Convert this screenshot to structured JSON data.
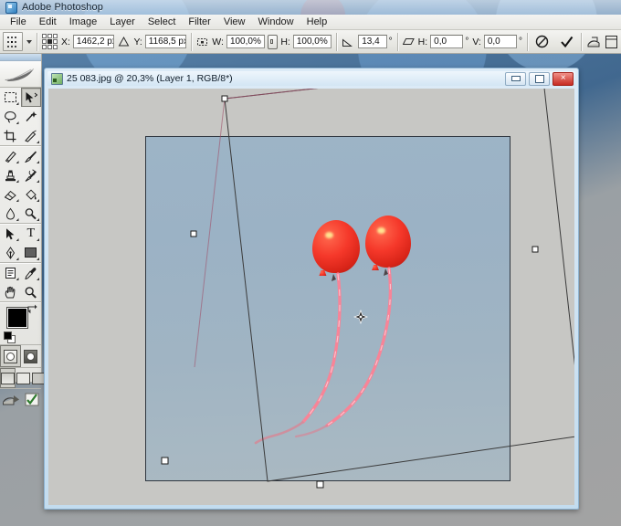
{
  "app": {
    "title": "Adobe Photoshop",
    "icon": "photoshop-icon"
  },
  "menubar": {
    "items": [
      {
        "label": "File"
      },
      {
        "label": "Edit"
      },
      {
        "label": "Image"
      },
      {
        "label": "Layer"
      },
      {
        "label": "Select"
      },
      {
        "label": "Filter"
      },
      {
        "label": "View"
      },
      {
        "label": "Window"
      },
      {
        "label": "Help"
      }
    ]
  },
  "options_bar": {
    "tool_preset_icon": "move-tool-preset-icon",
    "reference_point_label": "reference-point-grid",
    "reference_point_selected": "center",
    "x_label": "X:",
    "x_value": "1462,2 px",
    "delta_icon": "delta-triangle-icon",
    "y_label": "Y:",
    "y_value": "1168,5 px",
    "w_icon": "width-icon",
    "w_label": "W:",
    "w_value": "100,0%",
    "link_icon": "link-scale-icon",
    "h_label": "H:",
    "h_value": "100,0%",
    "angle_icon": "rotate-angle-icon",
    "angle_value": "13,4",
    "angle_unit": "°",
    "skew_icon": "skew-icon",
    "skew_h_label": "H:",
    "skew_h_value": "0,0",
    "skew_h_unit": "°",
    "skew_v_label": "V:",
    "skew_v_value": "0,0",
    "skew_v_unit": "°",
    "cancel_icon": "cancel-transform-icon",
    "commit_icon": "commit-transform-checkmark-icon",
    "warp_icon": "warp-mode-icon",
    "palette_icon": "palette-well-icon"
  },
  "toolbox": {
    "logo_icon": "photoshop-feather-logo",
    "tools": [
      {
        "name": "rectangular-marquee-tool",
        "icon": "marquee-icon",
        "selected": false,
        "has_flyout": true
      },
      {
        "name": "move-tool",
        "icon": "move-arrow-icon",
        "selected": true,
        "has_flyout": false
      },
      {
        "name": "lasso-tool",
        "icon": "lasso-icon",
        "selected": false,
        "has_flyout": true
      },
      {
        "name": "magic-wand-tool",
        "icon": "magic-wand-icon",
        "selected": false,
        "has_flyout": false
      },
      {
        "name": "crop-tool",
        "icon": "crop-icon",
        "selected": false,
        "has_flyout": false
      },
      {
        "name": "slice-tool",
        "icon": "slice-knife-icon",
        "selected": false,
        "has_flyout": true
      },
      {
        "name": "healing-brush-tool",
        "icon": "healing-brush-icon",
        "selected": false,
        "has_flyout": true
      },
      {
        "name": "brush-tool",
        "icon": "paintbrush-icon",
        "selected": false,
        "has_flyout": true
      },
      {
        "name": "clone-stamp-tool",
        "icon": "clone-stamp-icon",
        "selected": false,
        "has_flyout": true
      },
      {
        "name": "history-brush-tool",
        "icon": "history-brush-icon",
        "selected": false,
        "has_flyout": true
      },
      {
        "name": "eraser-tool",
        "icon": "eraser-icon",
        "selected": false,
        "has_flyout": true
      },
      {
        "name": "gradient-tool",
        "icon": "paint-bucket-icon",
        "selected": false,
        "has_flyout": true
      },
      {
        "name": "blur-tool",
        "icon": "blur-droplet-icon",
        "selected": false,
        "has_flyout": true
      },
      {
        "name": "dodge-tool",
        "icon": "dodge-burn-icon",
        "selected": false,
        "has_flyout": true
      },
      {
        "name": "path-selection-tool",
        "icon": "path-arrow-icon",
        "selected": false,
        "has_flyout": true
      },
      {
        "name": "type-tool",
        "icon": "type-t-icon",
        "selected": false,
        "has_flyout": true
      },
      {
        "name": "pen-tool",
        "icon": "pen-nib-icon",
        "selected": false,
        "has_flyout": true
      },
      {
        "name": "rectangle-shape-tool",
        "icon": "rectangle-shape-icon",
        "selected": false,
        "has_flyout": true
      },
      {
        "name": "notes-tool",
        "icon": "notes-icon",
        "selected": false,
        "has_flyout": true
      },
      {
        "name": "eyedropper-tool",
        "icon": "eyedropper-icon",
        "selected": false,
        "has_flyout": true
      },
      {
        "name": "hand-tool",
        "icon": "hand-icon",
        "selected": false,
        "has_flyout": false
      },
      {
        "name": "zoom-tool",
        "icon": "magnifier-icon",
        "selected": false,
        "has_flyout": false
      }
    ],
    "foreground_color": "#000000",
    "background_color": "#d4d0c8",
    "swap_colors_icon": "swap-colors-icon",
    "default_colors_icon": "default-colors-icon",
    "quick_mask": [
      {
        "name": "standard-mode-button",
        "selected": true
      },
      {
        "name": "quick-mask-mode-button",
        "selected": false
      }
    ],
    "screen_modes": [
      {
        "name": "standard-screen-mode-button",
        "selected": true
      },
      {
        "name": "full-screen-with-menubar-button",
        "selected": false
      },
      {
        "name": "full-screen-mode-button",
        "selected": false
      }
    ],
    "jump_to_icon": "jump-to-imageready-icon",
    "jump_to_check_icon": "imageready-check-icon"
  },
  "document_window": {
    "icon": "document-thumbnail-icon",
    "title": "25 083.jpg @ 20,3% (Layer 1, RGB/8*)",
    "file_name": "25 083.jpg",
    "zoom": "20,3%",
    "layer": "Layer 1",
    "color_mode": "RGB/8*",
    "minimize_label": "minimize-button",
    "restore_label": "restore-button",
    "close_label": "close-button",
    "close_glyph": "×"
  },
  "canvas": {
    "background_color": "#c7c7c4",
    "image_description": "Two red balloons with pink ribbons against a blue-grey sky",
    "sky_top_color": "#9db4c6",
    "sky_bottom_color": "#aab9c2",
    "balloon_color": "#f03a2e",
    "ribbon_color": "#ff7a8c",
    "transform": {
      "rotation_deg": "13,4",
      "reference_point_icon": "transform-reference-point-icon",
      "handle_name": "transform-handle",
      "bbox_name": "transform-bounding-box"
    }
  }
}
